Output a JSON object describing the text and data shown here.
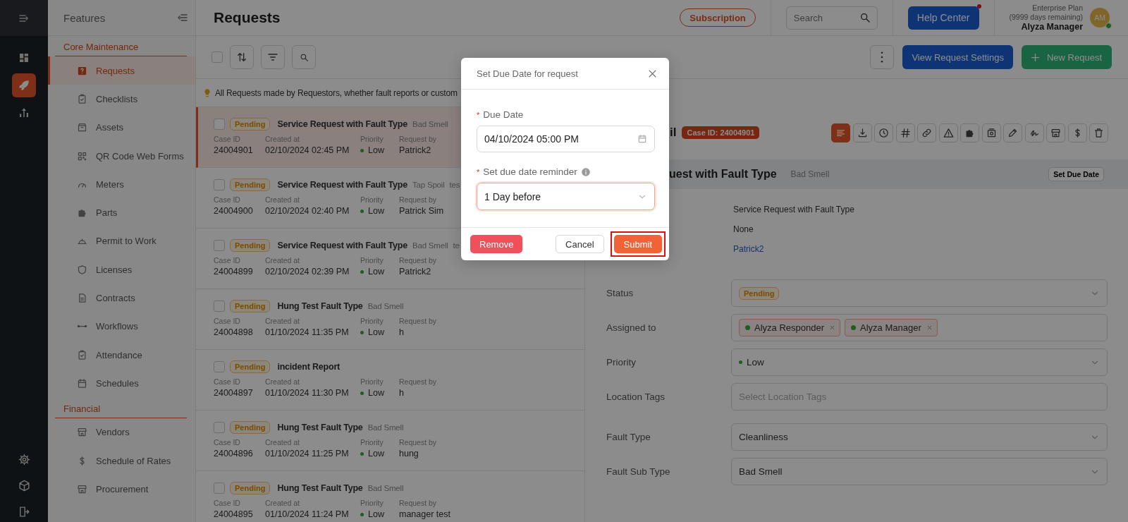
{
  "rail": {
    "items": [
      {
        "selected": false
      },
      {
        "selected": true
      },
      {
        "selected": false
      },
      {
        "selected": false
      },
      {
        "selected": false
      },
      {
        "selected": false
      }
    ]
  },
  "features": {
    "title": "Features",
    "sections": [
      {
        "heading": "Core Maintenance",
        "items": [
          {
            "label": "Requests",
            "selected": true
          },
          {
            "label": "Checklists",
            "selected": false
          },
          {
            "label": "Assets",
            "selected": false
          },
          {
            "label": "QR Code Web Forms",
            "selected": false
          },
          {
            "label": "Meters",
            "selected": false
          },
          {
            "label": "Parts",
            "selected": false
          },
          {
            "label": "Permit to Work",
            "selected": false
          },
          {
            "label": "Licenses",
            "selected": false
          },
          {
            "label": "Contracts",
            "selected": false
          },
          {
            "label": "Workflows",
            "selected": false
          },
          {
            "label": "Attendance",
            "selected": false
          },
          {
            "label": "Schedules",
            "selected": false
          }
        ]
      },
      {
        "heading": "Financial",
        "items": [
          {
            "label": "Vendors",
            "selected": false
          },
          {
            "label": "Schedule of Rates",
            "selected": false
          },
          {
            "label": "Procurement",
            "selected": false
          }
        ]
      }
    ]
  },
  "header": {
    "title": "Requests",
    "subscription": "Subscription",
    "search": {
      "placeholder": "Search"
    },
    "help": "Help Center",
    "plan": "Enterprise Plan",
    "plan_days": "(9999 days remaining)",
    "user": "Alyza Manager",
    "avatar": "AM"
  },
  "toolbar": {
    "select_all_checked": false,
    "settings_button": "View Request Settings",
    "new_button": "New Request"
  },
  "info": "All Requests made by Requestors, whether fault reports or custom",
  "requests": [
    {
      "status": "Pending",
      "title": "Service Request with Fault Type",
      "tag": "Bad Smell",
      "labels": [
        "Case ID",
        "Created at",
        "Priority",
        "Request by"
      ],
      "case_id": "24004901",
      "created": "02/10/2024 02:45 PM",
      "priority": "Low",
      "requester": "Patrick2",
      "selected": true,
      "checked": false
    },
    {
      "status": "Pending",
      "title": "Service Request with Fault Type",
      "tag": "Tap Spoil",
      "extra": "tes",
      "labels": [
        "Case ID",
        "Created at",
        "Priority",
        "Request by"
      ],
      "case_id": "24004900",
      "created": "02/10/2024 02:40 PM",
      "priority": "Low",
      "requester": "Patrick Sim",
      "selected": false,
      "checked": false
    },
    {
      "status": "Pending",
      "title": "Service Request with Fault Type",
      "tag": "Bad Smell",
      "extra": "te",
      "labels": [
        "Case ID",
        "Created at",
        "Priority",
        "Request by"
      ],
      "case_id": "24004899",
      "created": "02/10/2024 02:39 PM",
      "priority": "Low",
      "requester": "Patrick2",
      "selected": false,
      "checked": false
    },
    {
      "status": "Pending",
      "title": "Hung Test Fault Type",
      "tag": "Bad Smell",
      "labels": [
        "Case ID",
        "Created at",
        "Priority",
        "Request by"
      ],
      "case_id": "24004898",
      "created": "01/10/2024 11:35 PM",
      "priority": "Low",
      "requester": "h",
      "selected": false,
      "checked": false
    },
    {
      "status": "Pending",
      "title": "incident Report",
      "labels": [
        "Case ID",
        "Created at",
        "Priority",
        "Request by"
      ],
      "case_id": "24004897",
      "created": "01/10/2024 11:30 PM",
      "priority": "Low",
      "requester": "h",
      "selected": false,
      "checked": false
    },
    {
      "status": "Pending",
      "title": "Hung Test Fault Type",
      "tag": "Bad Smell",
      "labels": [
        "Case ID",
        "Created at",
        "Priority",
        "Request by"
      ],
      "case_id": "24004896",
      "created": "01/10/2024 11:25 PM",
      "priority": "Low",
      "requester": "hung",
      "selected": false,
      "checked": false
    },
    {
      "status": "Pending",
      "title": "Hung Test Fault Type",
      "tag": "Bad Smell",
      "labels": [
        "Case ID",
        "Created at",
        "Priority",
        "Request by"
      ],
      "case_id": "24004895",
      "created": "01/10/2024 11:24 PM",
      "priority": "Low",
      "requester": "manager test",
      "selected": false,
      "checked": false
    }
  ],
  "detail": {
    "header_fragment": "il",
    "case_badge": "Case ID: 24004901",
    "tools": [
      {
        "selected": true
      },
      {
        "selected": false
      },
      {
        "selected": false
      },
      {
        "selected": false
      },
      {
        "selected": false
      },
      {
        "selected": false
      },
      {
        "selected": false
      },
      {
        "selected": false
      },
      {
        "selected": false
      },
      {
        "selected": false
      },
      {
        "selected": false
      },
      {
        "selected": false
      },
      {
        "selected": false
      }
    ],
    "title_fragment": "uest with Fault Type",
    "title_tag": "Bad Smell",
    "due_button": "Set Due Date",
    "info_values": [
      {
        "text": "Service Request with Fault Type",
        "kind": "text"
      },
      {
        "text": "None",
        "kind": "text"
      },
      {
        "text": "Patrick2",
        "kind": "link"
      }
    ],
    "fields": [
      {
        "label": "Status",
        "kind": "status",
        "value": "Pending"
      },
      {
        "label": "Assigned to",
        "kind": "tags",
        "tags": [
          "Alyza Responder",
          "Alyza Manager"
        ]
      },
      {
        "label": "Priority",
        "kind": "priority",
        "value": "Low"
      },
      {
        "label": "Location Tags",
        "kind": "select",
        "placeholder": "Select Location Tags"
      },
      {
        "label": "Fault Type",
        "kind": "select",
        "value": "Cleanliness"
      },
      {
        "label": "Fault Sub Type",
        "kind": "select",
        "value": "Bad Smell"
      }
    ]
  },
  "modal": {
    "title": "Set Due Date for request",
    "due_mark": "*",
    "due_label": "Due Date",
    "due_value": "04/10/2024 05:00 PM",
    "reminder_mark": "*",
    "reminder_label": "Set due date reminder",
    "reminder_value": "1 Day before",
    "remove": "Remove",
    "cancel": "Cancel",
    "submit": "Submit",
    "submit_highlighted": true
  }
}
